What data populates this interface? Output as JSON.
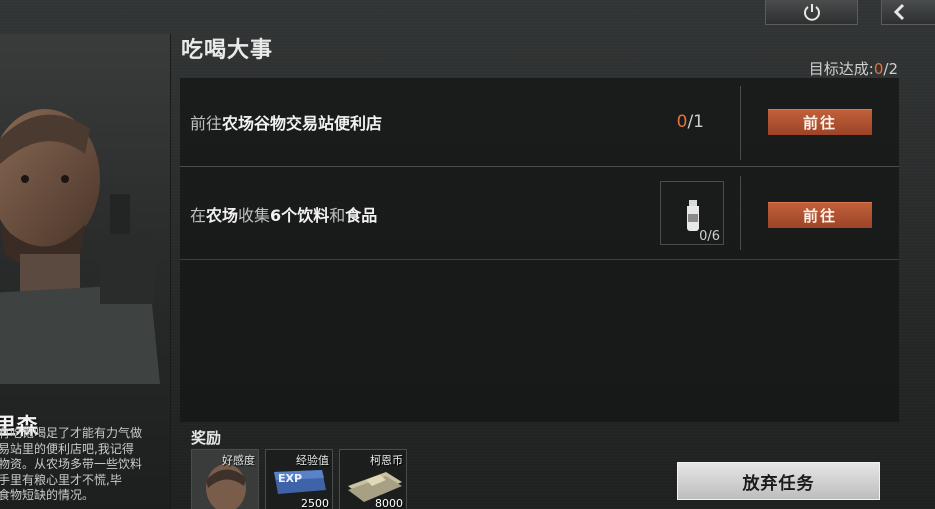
{
  "header": {
    "title": "吃喝大事",
    "goal_label": "目标达成:",
    "goal_done": "0",
    "goal_total": "/2"
  },
  "top_buttons": {
    "power_icon": "power-icon",
    "back_icon": "back-arrow-icon"
  },
  "character": {
    "name": "里森",
    "description": "有吃饱喝足了才能有力气做\n易站里的便利店吧,我记得\n物资。从农场多带一些饮料\n手里有粮心里才不慌,毕\n食物短缺的情况。"
  },
  "tasks": [
    {
      "prefix": "前往",
      "target": "农场谷物交易站便利店",
      "progress_done": "0",
      "progress_total": "/1",
      "button": "前往"
    },
    {
      "prefix": "在",
      "place": "农场",
      "mid": "收集",
      "count": "6个",
      "item1": "饮料",
      "and": "和",
      "item2": "食品",
      "item_count": "0/6",
      "button": "前往"
    }
  ],
  "rewards": {
    "label": "奖励",
    "items": [
      {
        "label": "好感度",
        "value": ""
      },
      {
        "label": "经验值",
        "value": "2500",
        "badge": "EXP"
      },
      {
        "label": "柯恩币",
        "value": "8000"
      }
    ]
  },
  "abandon_button": "放弃任务",
  "colors": {
    "accent": "#e4713c",
    "goto_button": "#b5583a"
  }
}
